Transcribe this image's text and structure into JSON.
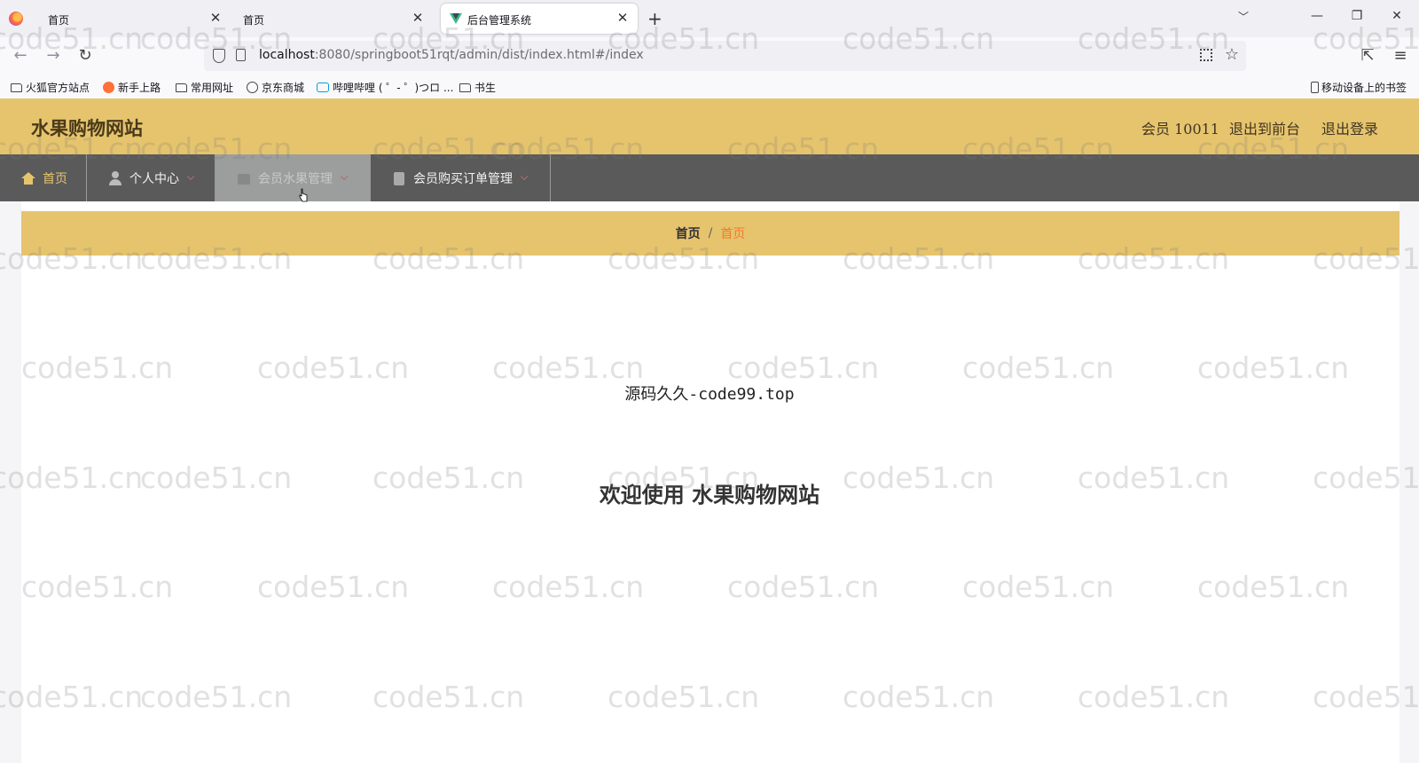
{
  "browser": {
    "tabs": [
      {
        "title": "首页",
        "close": "✕"
      },
      {
        "title": "首页",
        "close": "✕"
      },
      {
        "title": "后台管理系统",
        "close": "✕",
        "active": true
      }
    ],
    "new_tab": "+",
    "url_host": "localhost",
    "url_rest": ":8080/springboot51rqt/admin/dist/index.html#/index",
    "bookmarks": [
      "火狐官方站点",
      "新手上路",
      "常用网址",
      "京东商城",
      "哔哩哔哩 ( ゜- ゜)つロ ...",
      "书生"
    ],
    "mobile_bookmarks": "移动设备上的书签"
  },
  "header": {
    "site_title": "水果购物网站",
    "user_label": "会员 10011",
    "to_front": "退出到前台",
    "logout": "退出登录"
  },
  "menu": {
    "items": [
      {
        "label": "首页",
        "icon": "home-icon"
      },
      {
        "label": "个人中心",
        "icon": "user-icon"
      },
      {
        "label": "会员水果管理",
        "icon": "bag-icon"
      },
      {
        "label": "会员购买订单管理",
        "icon": "clipboard-icon"
      }
    ]
  },
  "breadcrumb": {
    "root": "首页",
    "separator": "/",
    "current": "首页"
  },
  "main": {
    "source_text": "源码久久-code99.top",
    "welcome": "欢迎使用 水果购物网站"
  },
  "watermark": "code51.cn",
  "colors": {
    "accent": "#e6c46e",
    "menu_bg": "#5a5a5a",
    "breadcrumb_active": "#f07b2c"
  }
}
